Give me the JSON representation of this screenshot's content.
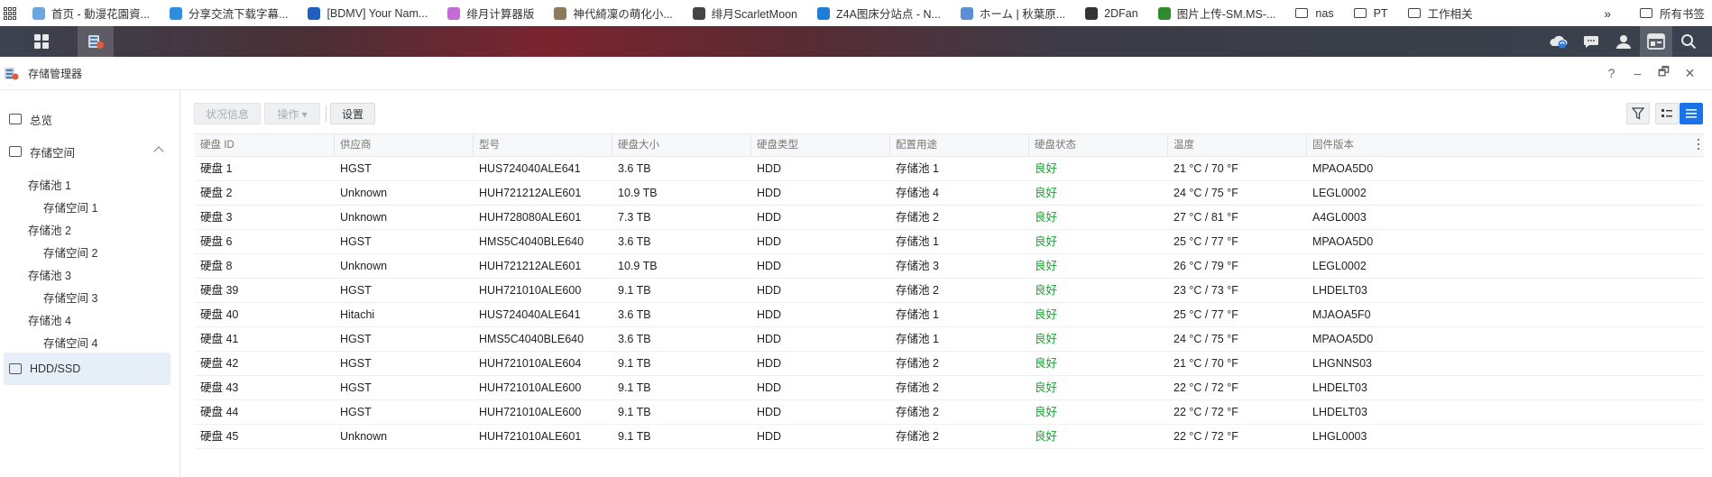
{
  "bookmarks": {
    "items": [
      {
        "label": "首页 - 動漫花園資...",
        "color": "#6aa7e0"
      },
      {
        "label": "分享交流下载字幕...",
        "color": "#2d8ee0"
      },
      {
        "label": "[BDMV] Your Nam...",
        "color": "#1f5fbf"
      },
      {
        "label": "绯月计算器版",
        "color": "#c46bd6"
      },
      {
        "label": "神代綺凜の萌化小...",
        "color": "#8c7a5a"
      },
      {
        "label": "绯月ScarletMoon",
        "color": "#444444"
      },
      {
        "label": "Z4A图床分站点 - N...",
        "color": "#1f7fd6"
      },
      {
        "label": "ホーム | 秋葉原...",
        "color": "#5b8fd6"
      },
      {
        "label": "2DFan",
        "color": "#333333"
      },
      {
        "label": "图片上传-SM.MS-...",
        "color": "#2e8b2e"
      }
    ],
    "folders": [
      "nas",
      "PT",
      "工作相关"
    ],
    "more": "»",
    "all_bookmarks": "所有书签"
  },
  "window": {
    "title": "存储管理器",
    "controls": [
      "?",
      "–",
      "🗗",
      "✕"
    ]
  },
  "sidebar": {
    "overview": "总览",
    "storage": "存储空间",
    "pools": [
      {
        "pool": "存储池 1",
        "volume": "存储空间 1"
      },
      {
        "pool": "存储池 2",
        "volume": "存储空间 2"
      },
      {
        "pool": "存储池 3",
        "volume": "存储空间 3"
      },
      {
        "pool": "存储池 4",
        "volume": "存储空间 4"
      }
    ],
    "hdd": "HDD/SSD"
  },
  "toolbar": {
    "status_info": "状况信息",
    "action": "操作 ▾",
    "settings": "设置"
  },
  "table": {
    "headers": [
      "硬盘 ID",
      "供应商",
      "型号",
      "硬盘大小",
      "硬盘类型",
      "配置用途",
      "硬盘状态",
      "温度",
      "固件版本"
    ],
    "rows": [
      [
        "硬盘 1",
        "HGST",
        "HUS724040ALE641",
        "3.6 TB",
        "HDD",
        "存储池 1",
        "良好",
        "21 °C / 70 °F",
        "MPAOA5D0"
      ],
      [
        "硬盘 2",
        "Unknown",
        "HUH721212ALE601",
        "10.9 TB",
        "HDD",
        "存储池 4",
        "良好",
        "24 °C / 75 °F",
        "LEGL0002"
      ],
      [
        "硬盘 3",
        "Unknown",
        "HUH728080ALE601",
        "7.3 TB",
        "HDD",
        "存储池 2",
        "良好",
        "27 °C / 81 °F",
        "A4GL0003"
      ],
      [
        "硬盘 6",
        "HGST",
        "HMS5C4040BLE640",
        "3.6 TB",
        "HDD",
        "存储池 1",
        "良好",
        "25 °C / 77 °F",
        "MPAOA5D0"
      ],
      [
        "硬盘 8",
        "Unknown",
        "HUH721212ALE601",
        "10.9 TB",
        "HDD",
        "存储池 3",
        "良好",
        "26 °C / 79 °F",
        "LEGL0002"
      ],
      [
        "硬盘 39",
        "HGST",
        "HUH721010ALE600",
        "9.1 TB",
        "HDD",
        "存储池 2",
        "良好",
        "23 °C / 73 °F",
        "LHDELT03"
      ],
      [
        "硬盘 40",
        "Hitachi",
        "HUS724040ALE641",
        "3.6 TB",
        "HDD",
        "存储池 1",
        "良好",
        "25 °C / 77 °F",
        "MJAOA5F0"
      ],
      [
        "硬盘 41",
        "HGST",
        "HMS5C4040BLE640",
        "3.6 TB",
        "HDD",
        "存储池 1",
        "良好",
        "24 °C / 75 °F",
        "MPAOA5D0"
      ],
      [
        "硬盘 42",
        "HGST",
        "HUH721010ALE604",
        "9.1 TB",
        "HDD",
        "存储池 2",
        "良好",
        "21 °C / 70 °F",
        "LHGNNS03"
      ],
      [
        "硬盘 43",
        "HGST",
        "HUH721010ALE600",
        "9.1 TB",
        "HDD",
        "存储池 2",
        "良好",
        "22 °C / 72 °F",
        "LHDELT03"
      ],
      [
        "硬盘 44",
        "HGST",
        "HUH721010ALE600",
        "9.1 TB",
        "HDD",
        "存储池 2",
        "良好",
        "22 °C / 72 °F",
        "LHDELT03"
      ],
      [
        "硬盘 45",
        "Unknown",
        "HUH721010ALE601",
        "9.1 TB",
        "HDD",
        "存储池 2",
        "良好",
        "22 °C / 72 °F",
        "LHGL0003"
      ]
    ]
  },
  "colors": {
    "accent": "#1a73e8",
    "good": "#18a12e",
    "sidebar_active": "#e6eef8"
  }
}
